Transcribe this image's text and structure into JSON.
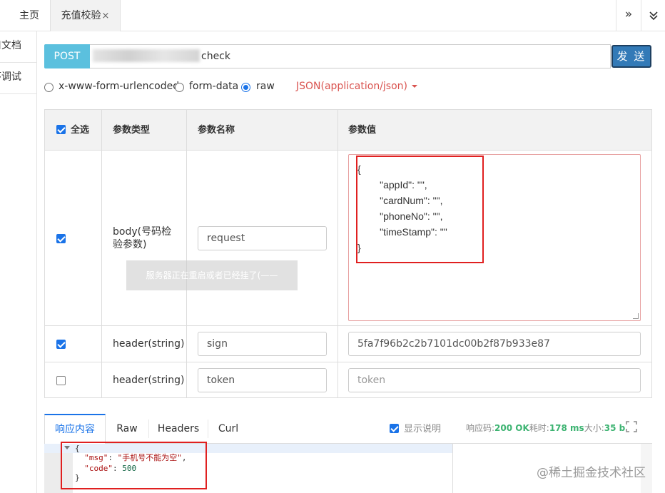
{
  "top_tabs": [
    {
      "label": "主页"
    },
    {
      "label": "充值校验",
      "close": "×"
    }
  ],
  "top_buttons": {
    "forward": "»",
    "collapse": "≫"
  },
  "left_menu": [
    {
      "label": "口文档"
    },
    {
      "label": "环调试"
    }
  ],
  "request": {
    "method": "POST",
    "url_suffix": "check",
    "send_label": "发 送"
  },
  "body_types": [
    {
      "label": "x-www-form-urlencoded",
      "selected": false
    },
    {
      "label": "form-data",
      "selected": false
    },
    {
      "label": "raw",
      "selected": true
    }
  ],
  "content_type": "JSON(application/json)",
  "params_table": {
    "headers": [
      "全选",
      "参数类型",
      "参数名称",
      "参数值"
    ],
    "select_all": true,
    "rows": [
      {
        "checked": true,
        "type": "body(号码检验参数)",
        "name": "request",
        "value": "{\n        \"appId\": \"\",\n        \"cardNum\": \"\",\n        \"phoneNo\": \"\",\n        \"timeStamp\": \"\"\n}"
      },
      {
        "checked": true,
        "type": "header(string)",
        "name": "sign",
        "value": "5fa7f96b2c2b7101dc00b2f87b933e87"
      },
      {
        "checked": false,
        "type": "header(string)",
        "name": "token",
        "value": "",
        "placeholder": "token"
      }
    ]
  },
  "toast": "服务器正在重启或者已经挂了(——",
  "response": {
    "tabs": [
      "响应内容",
      "Raw",
      "Headers",
      "Curl"
    ],
    "active_tab": "响应内容",
    "show_explain_label": "显示说明",
    "show_explain_checked": true,
    "status_prefix": "响应码:",
    "status_code": "200 OK",
    "time_prefix": "耗时:",
    "time_value": "178 ms",
    "size_prefix": "大小:",
    "size_value": "35 b",
    "body_lines": {
      "open": "{",
      "msg_key": "\"msg\"",
      "msg_value": "\"手机号不能为空\"",
      "code_key": "\"code\"",
      "code_value": "500",
      "close": "}"
    }
  },
  "watermark": "@稀土掘金技术社区",
  "colors": {
    "method_bg": "#5bc0de",
    "send_bg": "#337ab7",
    "accent_blue": "#1a73e8",
    "content_type": "#d9534f",
    "status_ok": "#3cb371",
    "highlight_box": "#e02020"
  }
}
